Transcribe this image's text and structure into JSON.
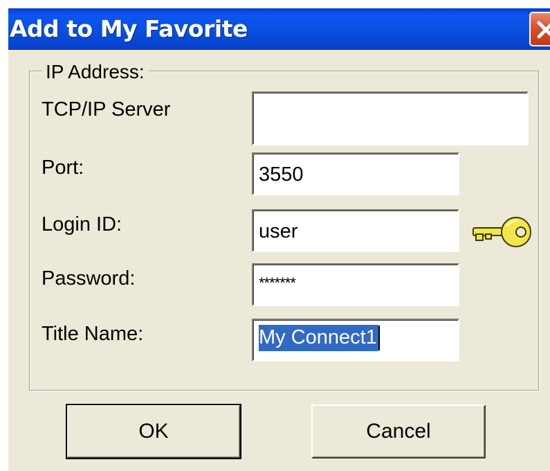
{
  "window": {
    "title": "Add to My Favorite",
    "close_icon": "close-x-icon",
    "accent_color": "#0a4fe0",
    "close_color": "#d5522c"
  },
  "group": {
    "legend": "IP Address:"
  },
  "fields": {
    "server": {
      "label": "TCP/IP Server",
      "value": ""
    },
    "port": {
      "label": "Port:",
      "value": "3550"
    },
    "login": {
      "label": "Login ID:",
      "value": "user"
    },
    "password": {
      "label": "Password:",
      "value": "*******"
    },
    "title_name": {
      "label": "Title Name:",
      "value": "My Connect1"
    }
  },
  "icons": {
    "key": "key-icon"
  },
  "buttons": {
    "ok": "OK",
    "cancel": "Cancel"
  }
}
